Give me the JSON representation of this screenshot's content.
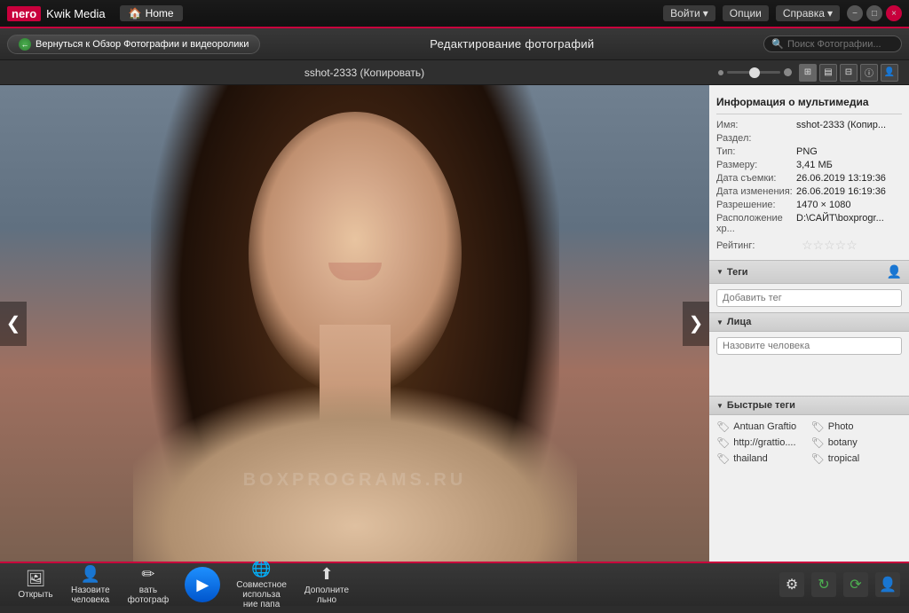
{
  "app": {
    "logo_nero": "nero",
    "logo_text": "Kwik Media",
    "home_label": "Home"
  },
  "title_bar": {
    "menu_login": "Войти",
    "menu_options": "Опции",
    "menu_help": "Справка"
  },
  "toolbar": {
    "back_label": "Вернуться к Обзор Фотографии и видеоролики",
    "page_title": "Редактирование фотографий",
    "search_placeholder": "Поиск Фотографии..."
  },
  "sub_toolbar": {
    "file_name": "sshot-2333 (Копировать)"
  },
  "info_panel": {
    "title": "Информация о мультимедиа",
    "name_label": "Имя:",
    "name_value": "sshot-2333 (Копир...",
    "section_label": "Раздел:",
    "section_value": "",
    "type_label": "Тип:",
    "type_value": "PNG",
    "size_label": "Размеру:",
    "size_value": "3,41 МБ",
    "shoot_date_label": "Дата съемки:",
    "shoot_date_value": "26.06.2019 13:19:36",
    "modify_date_label": "Дата изменения:",
    "modify_date_value": "26.06.2019 16:19:36",
    "resolution_label": "Разрешение:",
    "resolution_value": "1470 × 1080",
    "location_label": "Расположение хр...",
    "location_value": "D:\\САЙТ\\boxprogr...",
    "rating_label": "Рейтинг:",
    "stars": "☆☆☆☆☆"
  },
  "tags_section": {
    "title": "Теги",
    "input_placeholder": "Добавить тег"
  },
  "faces_section": {
    "title": "Лица",
    "input_placeholder": "Назовите человека"
  },
  "quick_tags_section": {
    "title": "Быстрые теги",
    "tags": [
      {
        "label": "Antuan Graftio"
      },
      {
        "label": "Photo"
      },
      {
        "label": "http://grattio...."
      },
      {
        "label": "botany"
      },
      {
        "label": "thailand"
      },
      {
        "label": "tropical"
      }
    ]
  },
  "bottom_toolbar": {
    "open_label": "Открыть",
    "name_person_label": "Назовите\nчеловека",
    "name_photo_label": "вать\nфотограф",
    "share_label": "Совместное\nиспольза\nние папа",
    "enhance_label": "Дополните\nльно",
    "watermark": "BOXPROGRAMS.RU"
  },
  "nav": {
    "prev": "❮",
    "next": "❯"
  },
  "view_buttons": [
    "⊞",
    "▤",
    "⊟",
    "ⓘ",
    "👤"
  ]
}
